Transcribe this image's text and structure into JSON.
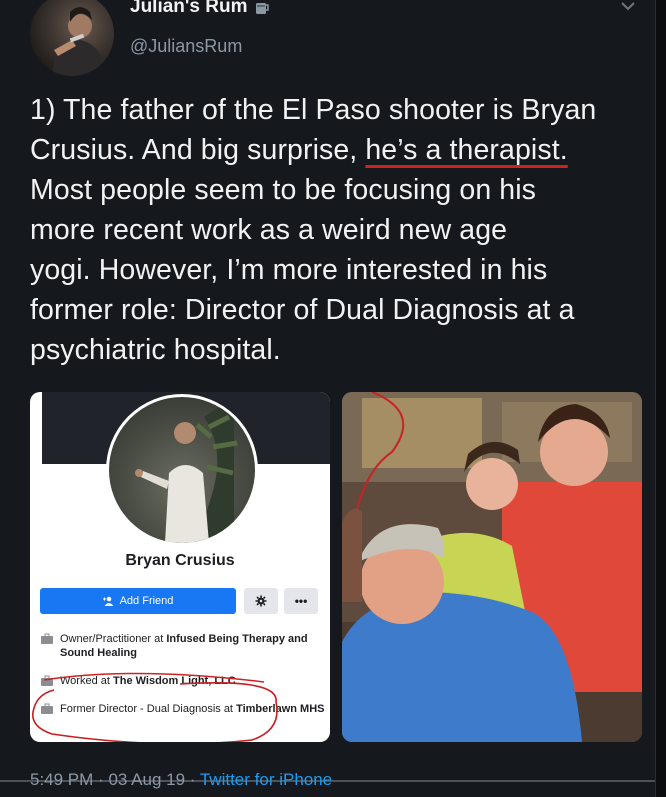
{
  "author": {
    "display_name": "Julian's Rum",
    "handle": "@JuliansRum",
    "badge_icon": "mug-icon"
  },
  "tweet": {
    "lines": [
      "1) The father of the El Paso shooter is Bryan",
      "Crusius. And big surprise, ",
      "he’s a therapist.",
      "Most people seem to be focusing on his",
      "more recent work as a weird new age",
      "yogi. However, I’m more interested in his",
      "former role: Director of Dual Diagnosis at a",
      "psychiatric hospital."
    ],
    "underline_color": "#d0201f"
  },
  "profile_card": {
    "name": "Bryan Crusius",
    "add_friend_label": "Add Friend",
    "more_label": "•••",
    "entries": [
      {
        "prefix": "Owner/Practitioner at ",
        "place": "Infused Being Therapy and Sound Healing"
      },
      {
        "prefix": "Worked at ",
        "place": "The Wisdom Light, LLC"
      },
      {
        "prefix": "Former Director - Dual Diagnosis at ",
        "place": "Timberlawn MHS"
      }
    ]
  },
  "timestamp": {
    "time": "5:49 PM",
    "date": "03 Aug 19",
    "separator": "·",
    "source": "Twitter for iPhone"
  },
  "colors": {
    "background": "#15181c",
    "link_blue": "#1d9bf0",
    "facebook_blue": "#1877f2"
  }
}
